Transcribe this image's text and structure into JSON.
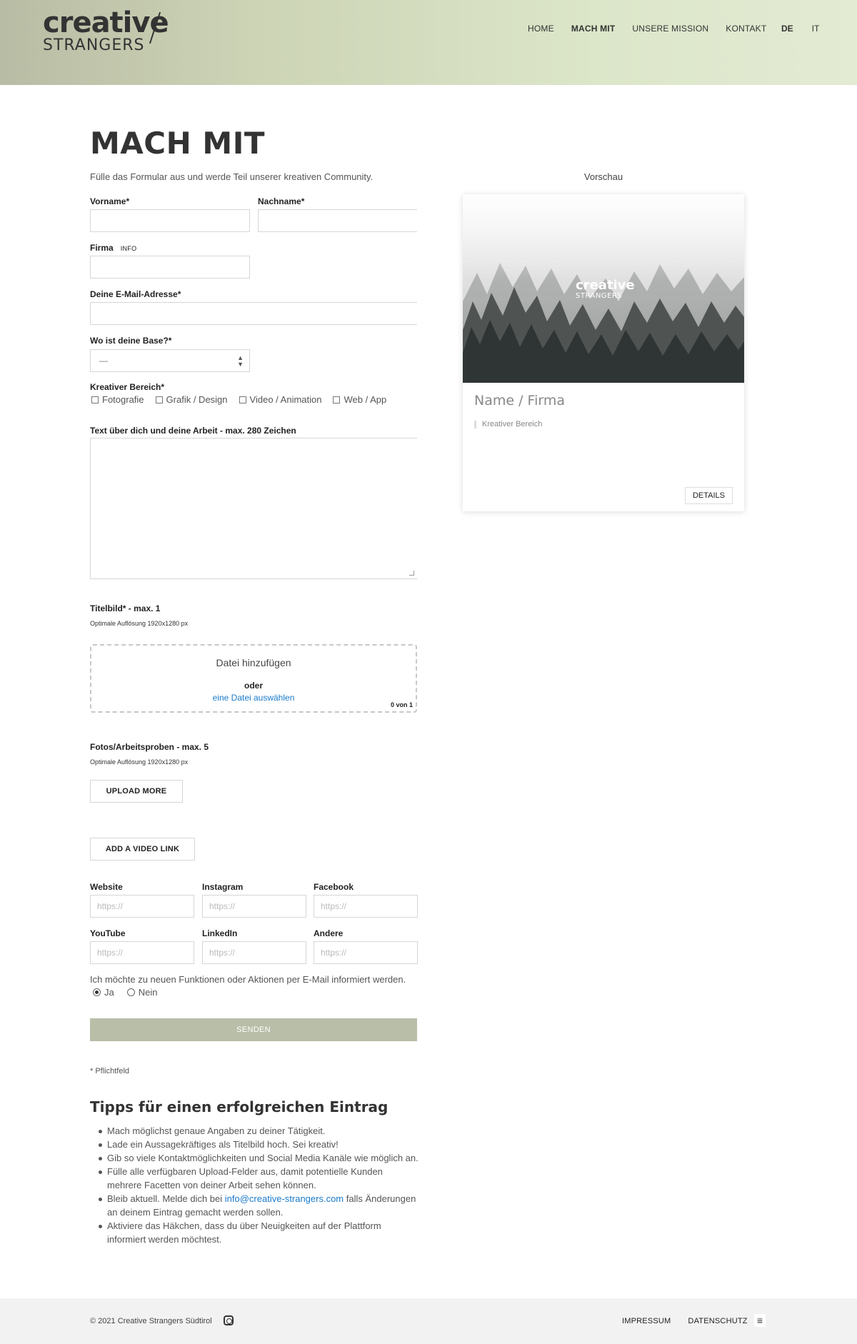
{
  "header": {
    "logo_top": "creative",
    "logo_bottom": "STRANGERS",
    "nav": [
      "HOME",
      "MACH MIT",
      "UNSERE MISSION",
      "KONTAKT"
    ],
    "lang": [
      "DE",
      "IT"
    ]
  },
  "page": {
    "title": "MACH MIT",
    "intro": "Fülle das Formular aus und werde Teil unserer kreativen Community."
  },
  "form": {
    "vorname": "Vorname*",
    "nachname": "Nachname*",
    "firma": "Firma",
    "firma_info": "INFO",
    "email": "Deine E-Mail-Adresse*",
    "base": "Wo ist deine Base?*",
    "base_value": "—",
    "bereich": "Kreativer Bereich*",
    "bereich_options": [
      "Fotografie",
      "Grafik / Design",
      "Video / Animation",
      "Web / App"
    ],
    "text_label": "Text über dich und deine Arbeit - max. 280 Zeichen",
    "titelbild": "Titelbild* - max. 1",
    "aufloesung": "Optimale Auflösung 1920x1280 px",
    "drop_add": "Datei hinzufügen",
    "drop_or": "oder",
    "drop_choose": "eine Datei auswählen",
    "drop_count": "0 von 1",
    "fotos": "Fotos/Arbeitsproben - max. 5",
    "aufloesung2": "Optimale Auflösung 1920x1280 px",
    "upload_more": "UPLOAD MORE",
    "video_link": "ADD A VIDEO LINK",
    "social": [
      {
        "label": "Website",
        "placeholder": "https://"
      },
      {
        "label": "Instagram",
        "placeholder": "https://"
      },
      {
        "label": "Facebook",
        "placeholder": "https://"
      },
      {
        "label": "YouTube",
        "placeholder": "https://"
      },
      {
        "label": "LinkedIn",
        "placeholder": "https://"
      },
      {
        "label": "Andere",
        "placeholder": "https://"
      }
    ],
    "newsletter": "Ich möchte zu neuen Funktionen oder Aktionen per E-Mail informiert werden.",
    "yes": "Ja",
    "no": "Nein",
    "send": "SENDEN",
    "required": "* Pflichtfeld"
  },
  "tips": {
    "title": "Tipps für einen erfolgreichen Eintrag",
    "items": [
      "Mach möglichst genaue Angaben zu deiner Tätigkeit.",
      "Lade ein Aussagekräftiges als Titelbild hoch. Sei kreativ!",
      "Gib so viele Kontaktmöglichkeiten und Social Media Kanäle wie möglich an.",
      "Fülle alle verfügbaren Upload-Felder aus, damit potentielle Kunden mehrere Facetten von deiner Arbeit sehen können."
    ],
    "item5_pre": "Bleib aktuell. Melde dich bei ",
    "item5_link": "info@creative-strangers.com",
    "item5_post": " falls Änderungen an deinem Eintrag gemacht werden sollen.",
    "item6": "Aktiviere das Häkchen, dass du über Neuigkeiten auf der Plattform informiert werden möchtest."
  },
  "preview": {
    "label": "Vorschau",
    "logo_top": "creative",
    "logo_bottom": "STRANGERS",
    "name": "Name / Firma",
    "category": "Kreativer Bereich",
    "details": "DETAILS"
  },
  "footer": {
    "copyright": "© 2021 Creative Strangers Südtirol",
    "links": [
      "IMPRESSUM",
      "DATENSCHUTZ"
    ]
  }
}
